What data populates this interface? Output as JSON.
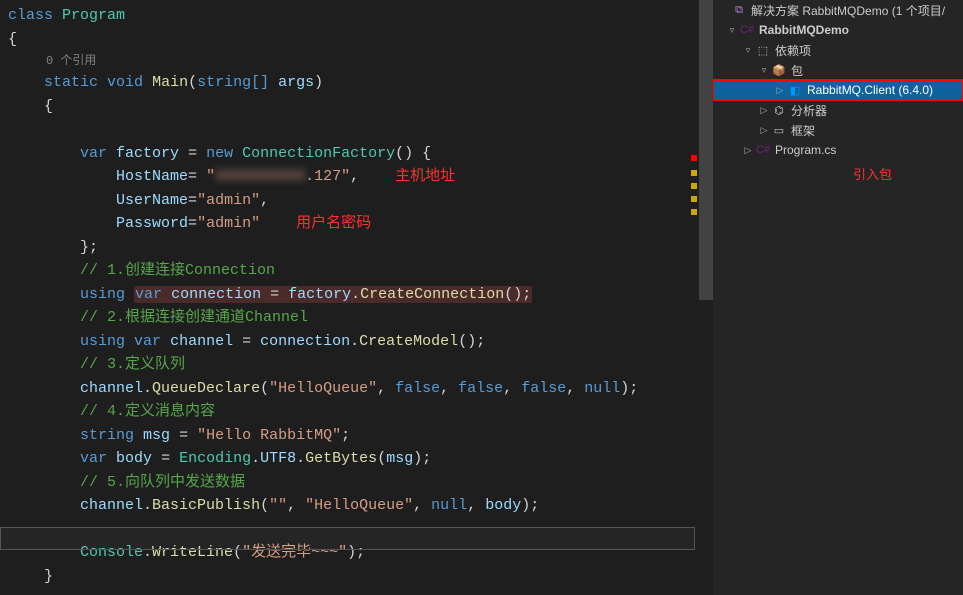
{
  "editor": {
    "ref_hint": "0 个引用",
    "annotations": {
      "host": "主机地址",
      "credentials": "用户名密码"
    },
    "lines": {
      "class_kw": "class",
      "class_name": "Program",
      "open_brace": "{",
      "static_kw": "static",
      "void_kw": "void",
      "main": "Main",
      "string_arr": "string[]",
      "args": "args",
      "var_kw": "var",
      "new_kw": "new",
      "using_kw": "using",
      "factory_var": "factory",
      "conn_factory": "ConnectionFactory",
      "hostname_prop": "HostName",
      "host_val": "\"          .127\"",
      "username_prop": "UserName",
      "admin_val": "\"admin\"",
      "password_prop": "Password",
      "comment1": "// 1.创建连接Connection",
      "connection_var": "connection",
      "create_conn": "CreateConnection",
      "comment2": "// 2.根据连接创建通道Channel",
      "channel_var": "channel",
      "create_model": "CreateModel",
      "comment3": "// 3.定义队列",
      "queue_declare": "QueueDeclare",
      "hello_queue": "\"HelloQueue\"",
      "false_kw": "false",
      "null_kw": "null",
      "comment4": "// 4.定义消息内容",
      "string_kw": "string",
      "msg_var": "msg",
      "hello_rabbit": "\"Hello RabbitMQ\"",
      "body_var": "body",
      "encoding": "Encoding",
      "utf8": "UTF8",
      "getbytes": "GetBytes",
      "comment5": "// 5.向队列中发送数据",
      "basic_publish": "BasicPublish",
      "empty_str": "\"\"",
      "console": "Console",
      "writeline": "WriteLine",
      "finish_str": "\"发送完毕~~~\"",
      "close_brace": "}"
    }
  },
  "solution": {
    "title": "解决方案 RabbitMQDemo (1 个项目/",
    "items": [
      {
        "indent": 8,
        "exp": "▿",
        "icon": "C#",
        "icon_color": "#68217a",
        "label": "RabbitMQDemo",
        "bold": true
      },
      {
        "indent": 24,
        "exp": "▿",
        "icon": "⬚",
        "icon_color": "#c5c5c5",
        "label": "依赖项"
      },
      {
        "indent": 40,
        "exp": "▿",
        "icon": "📦",
        "icon_color": "#c5c5c5",
        "label": "包"
      },
      {
        "indent": 56,
        "exp": "▷",
        "icon": "◧",
        "icon_color": "#0098ff",
        "label": "RabbitMQ.Client (6.4.0)",
        "selected": true,
        "highlight_red": true
      },
      {
        "indent": 40,
        "exp": "▷",
        "icon": "⌬",
        "icon_color": "#c5c5c5",
        "label": "分析器"
      },
      {
        "indent": 40,
        "exp": "▷",
        "icon": "▭",
        "icon_color": "#c5c5c5",
        "label": "框架"
      },
      {
        "indent": 24,
        "exp": "▷",
        "icon": "C#",
        "icon_color": "#68217a",
        "label": "Program.cs"
      }
    ],
    "annotation": "引入包"
  }
}
